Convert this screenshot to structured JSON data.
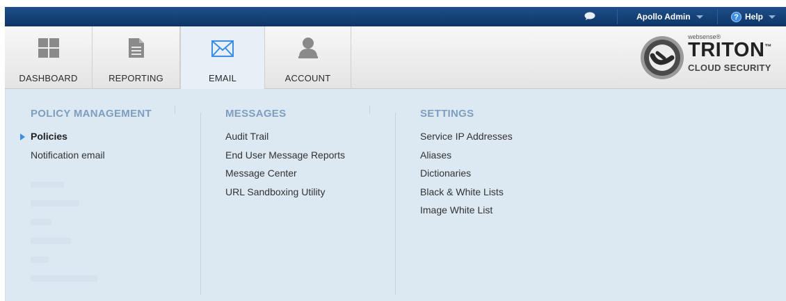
{
  "topbar": {
    "chat_icon": "chat-bubble-icon",
    "user_label": "Apollo Admin",
    "help_label": "Help",
    "help_icon": "question-icon"
  },
  "nav": {
    "tabs": [
      {
        "label": "DASHBOARD",
        "icon": "dashboard-grid-icon"
      },
      {
        "label": "REPORTING",
        "icon": "document-icon"
      },
      {
        "label": "EMAIL",
        "icon": "envelope-icon",
        "active": true
      },
      {
        "label": "ACCOUNT",
        "icon": "user-icon"
      }
    ]
  },
  "brand": {
    "small": "websense®",
    "name": "TRITON",
    "trademark": "™",
    "sub": "CLOUD SECURITY"
  },
  "menu": {
    "policy": {
      "heading": "POLICY MANAGEMENT",
      "items": [
        "Policies",
        "Notification email"
      ],
      "active_index": 0
    },
    "messages": {
      "heading": "MESSAGES",
      "items": [
        "Audit Trail",
        "End User Message Reports",
        "Message Center",
        "URL Sandboxing Utility"
      ]
    },
    "settings": {
      "heading": "SETTINGS",
      "items": [
        "Service IP Addresses",
        "Aliases",
        "Dictionaries",
        "Black & White Lists",
        "Image White List"
      ]
    }
  },
  "colors": {
    "topbar": "#123d70",
    "content_bg": "#dce8f2",
    "heading": "#7e9ec0",
    "accent": "#3b8ee6"
  }
}
